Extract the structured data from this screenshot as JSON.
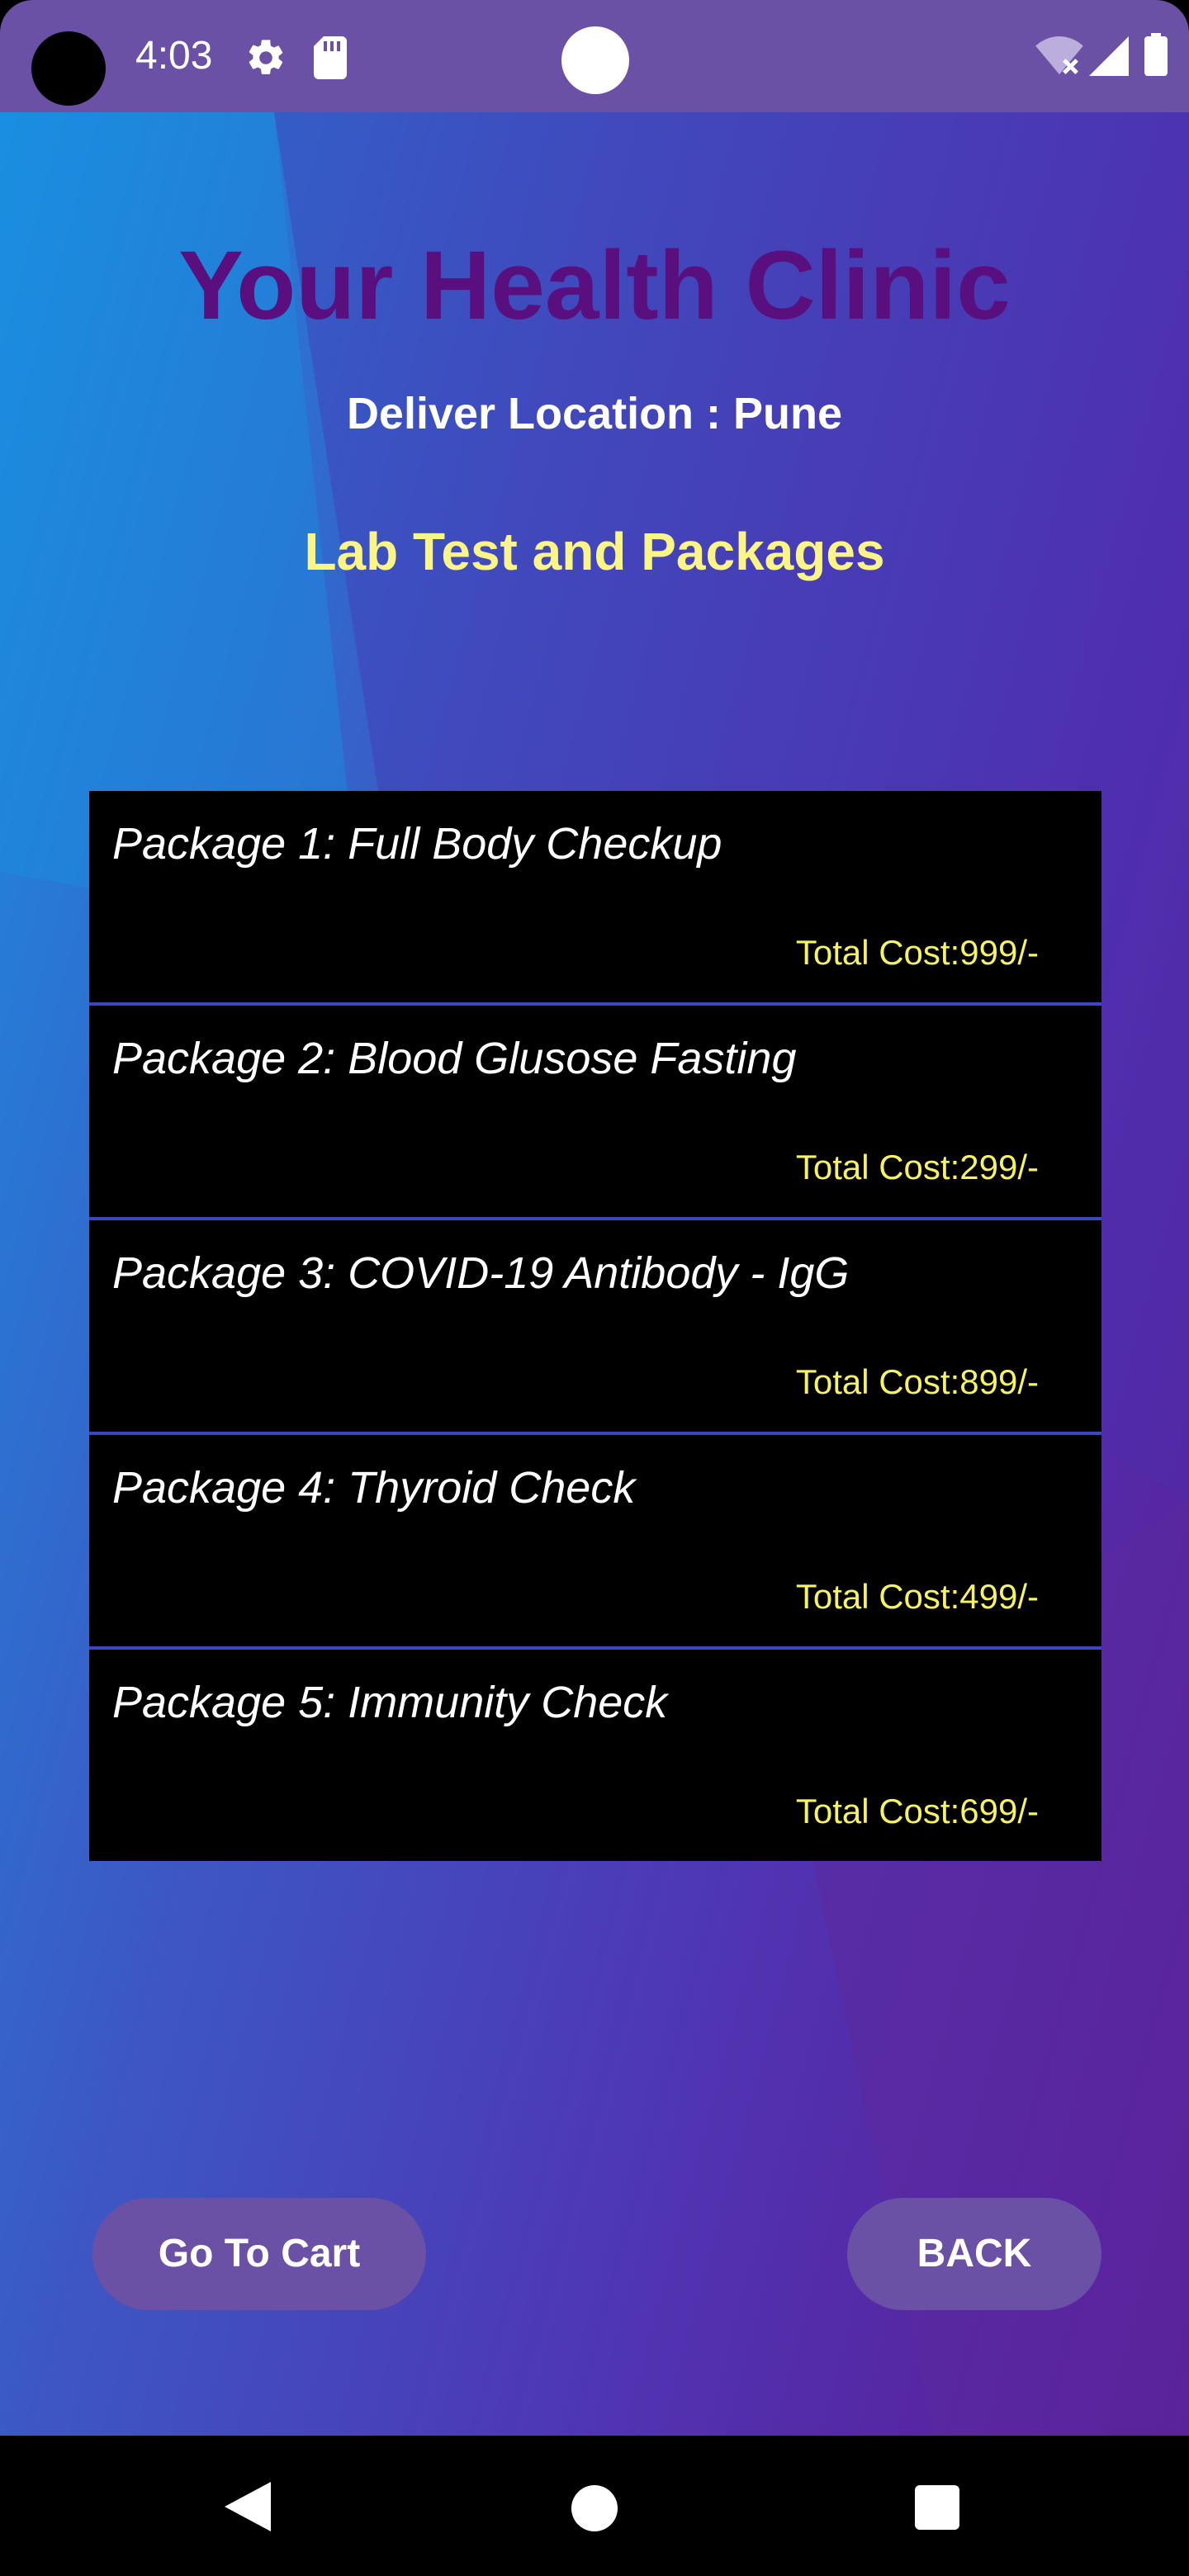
{
  "status_bar": {
    "time": "4:03",
    "icons": [
      "gear-icon",
      "sd-card-icon",
      "wifi-off-icon",
      "signal-icon",
      "battery-icon"
    ]
  },
  "header": {
    "title": "Your Health Clinic",
    "deliver_location": "Deliver Location : Pune",
    "section_heading": "Lab Test and Packages"
  },
  "packages": [
    {
      "name": "Package 1: Full Body Checkup",
      "cost": "Total Cost:999/-"
    },
    {
      "name": "Package 2: Blood Glusose Fasting",
      "cost": "Total Cost:299/-"
    },
    {
      "name": "Package 3: COVID-19 Antibody - IgG",
      "cost": "Total Cost:899/-"
    },
    {
      "name": "Package 4: Thyroid Check",
      "cost": "Total Cost:499/-"
    },
    {
      "name": "Package 5: Immunity Check",
      "cost": "Total Cost:699/-"
    }
  ],
  "buttons": {
    "cart_label": "Go To Cart",
    "back_label": "BACK"
  },
  "nav_bar": {
    "icons": [
      "back-icon",
      "home-icon",
      "recents-icon"
    ]
  },
  "colors": {
    "title": "#5a0f7f",
    "heading": "#fbf486",
    "cost": "#f6f262",
    "button": "#6a51a6",
    "status_bar": "#6a51a6",
    "list_background": "#000000"
  }
}
